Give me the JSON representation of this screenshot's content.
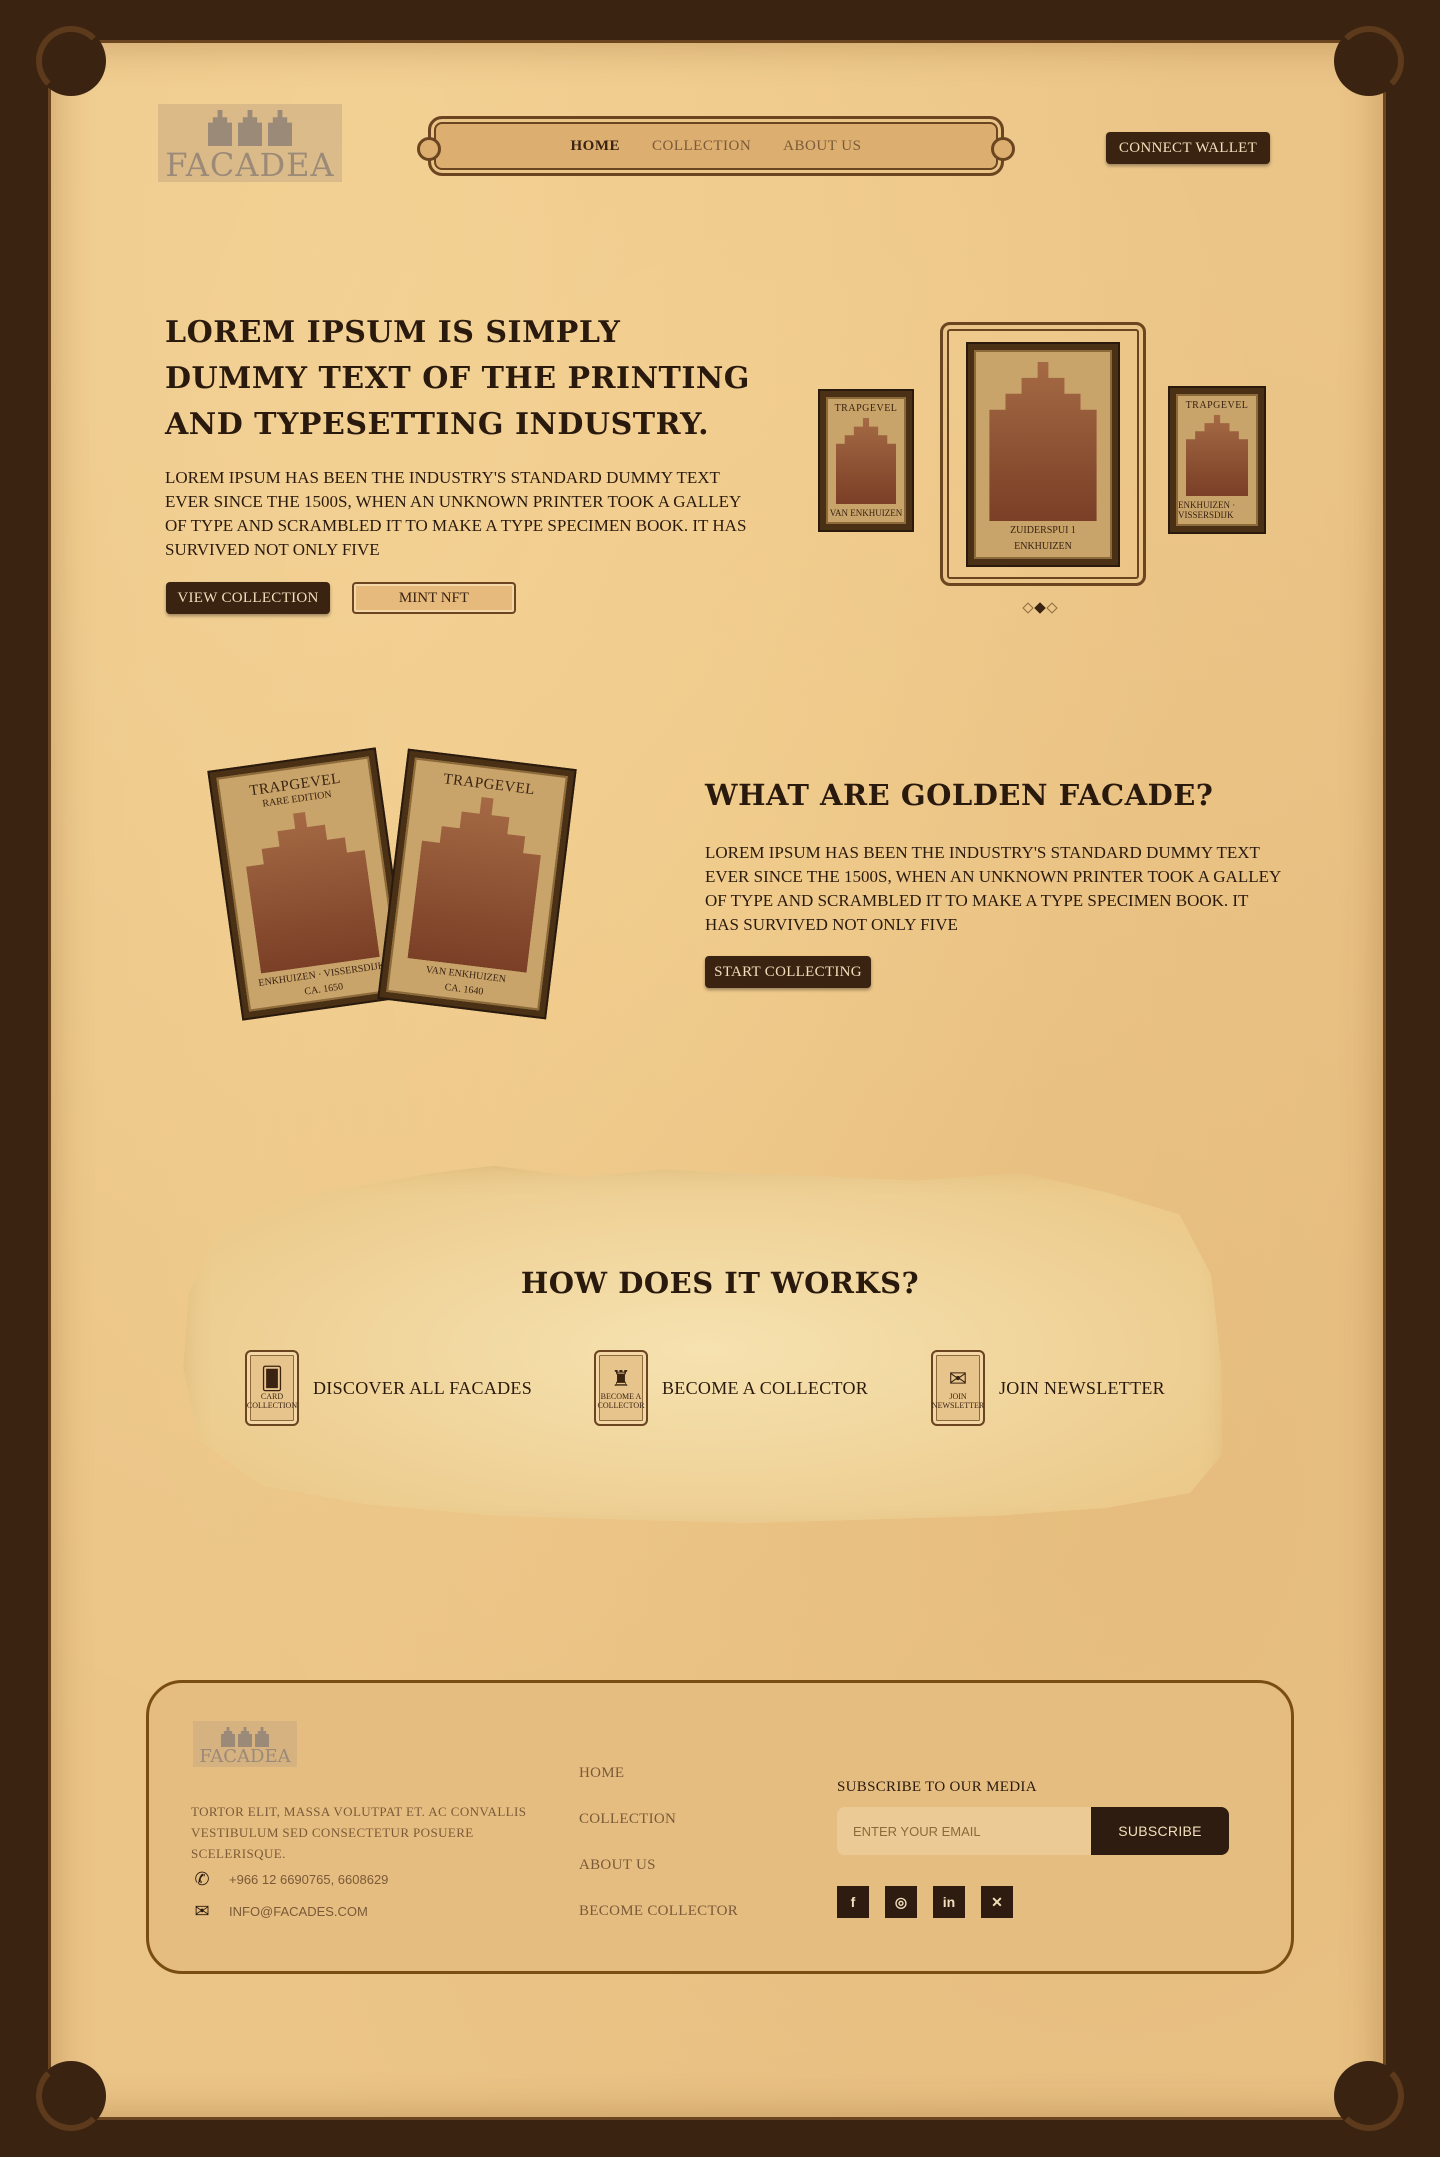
{
  "brand": {
    "logo_text": "FACADEA"
  },
  "nav": {
    "items": [
      {
        "label": "HOME",
        "active": true
      },
      {
        "label": "COLLECTION",
        "active": false
      },
      {
        "label": "ABOUT US",
        "active": false
      }
    ],
    "connect_label": "CONNECT WALLET"
  },
  "hero": {
    "title": "LOREM IPSUM IS SIMPLY DUMMY TEXT OF THE PRINTING AND TYPESETTING INDUSTRY.",
    "body": "LOREM IPSUM HAS BEEN THE INDUSTRY'S STANDARD DUMMY TEXT EVER SINCE THE 1500S, WHEN AN UNKNOWN PRINTER TOOK A GALLEY OF TYPE AND SCRAMBLED IT TO MAKE A TYPE SPECIMEN BOOK. IT HAS SURVIVED NOT ONLY FIVE",
    "view_label": "VIEW COLLECTION",
    "mint_label": "MINT NFT"
  },
  "carousel": {
    "left": {
      "title": "TRAPGEVEL",
      "foot": "VAN ENKHUIZEN"
    },
    "center": {
      "foot_line1": "ZUIDERSPUI 1",
      "foot_line2": "ENKHUIZEN"
    },
    "right": {
      "title": "TRAPGEVEL",
      "foot": "ENKHUIZEN · VISSERSDIJK"
    },
    "active_index": 1,
    "dot_count": 3
  },
  "golden": {
    "title": "WHAT ARE GOLDEN FACADE?",
    "body": "LOREM IPSUM HAS BEEN THE INDUSTRY'S STANDARD DUMMY TEXT EVER SINCE THE 1500S, WHEN AN UNKNOWN PRINTER TOOK A GALLEY OF TYPE AND SCRAMBLED IT TO MAKE A TYPE SPECIMEN BOOK. IT HAS SURVIVED NOT ONLY FIVE",
    "cta_label": "START COLLECTING",
    "card1": {
      "title": "TRAPGEVEL",
      "sub": "RARE EDITION",
      "foot": "ENKHUIZEN · VISSERSDIJK",
      "year": "CA. 1650"
    },
    "card2": {
      "title": "TRAPGEVEL",
      "foot": "VAN ENKHUIZEN",
      "year": "CA. 1640"
    }
  },
  "how": {
    "title": "HOW DOES IT WORKS?",
    "steps": [
      {
        "badge": "CARD COLLECTION",
        "label": "DISCOVER ALL FACADES",
        "icon": "cards-icon"
      },
      {
        "badge": "BECOME A COLLECTOR",
        "label": "BECOME A COLLECTOR",
        "icon": "collector-icon"
      },
      {
        "badge": "JOIN NEWSLETTER",
        "label": "JOIN NEWSLETTER",
        "icon": "newsletter-icon"
      }
    ]
  },
  "footer": {
    "logo_text": "FACADEA",
    "description": "TORTOR ELIT, MASSA VOLUTPAT ET. AC CONVALLIS VESTIBULUM SED CONSECTETUR POSUERE SCELERISQUE.",
    "phone": "+966 12 6690765, 6608629",
    "email": "INFO@FACADES.COM",
    "links": [
      "HOME",
      "COLLECTION",
      "ABOUT US",
      "BECOME COLLECTOR"
    ],
    "subscribe_title": "SUBSCRIBE TO OUR MEDIA",
    "email_placeholder": "ENTER YOUR EMAIL",
    "subscribe_label": "SUBSCRIBE",
    "social": [
      {
        "icon": "facebook-icon",
        "glyph": "f"
      },
      {
        "icon": "instagram-icon",
        "glyph": "◎"
      },
      {
        "icon": "linkedin-icon",
        "glyph": "in"
      },
      {
        "icon": "x-icon",
        "glyph": "✕"
      }
    ]
  },
  "colors": {
    "paper": "#ebc487",
    "frame": "#3a2311",
    "ink": "#2a1a0e",
    "accent": "#6b4520"
  }
}
